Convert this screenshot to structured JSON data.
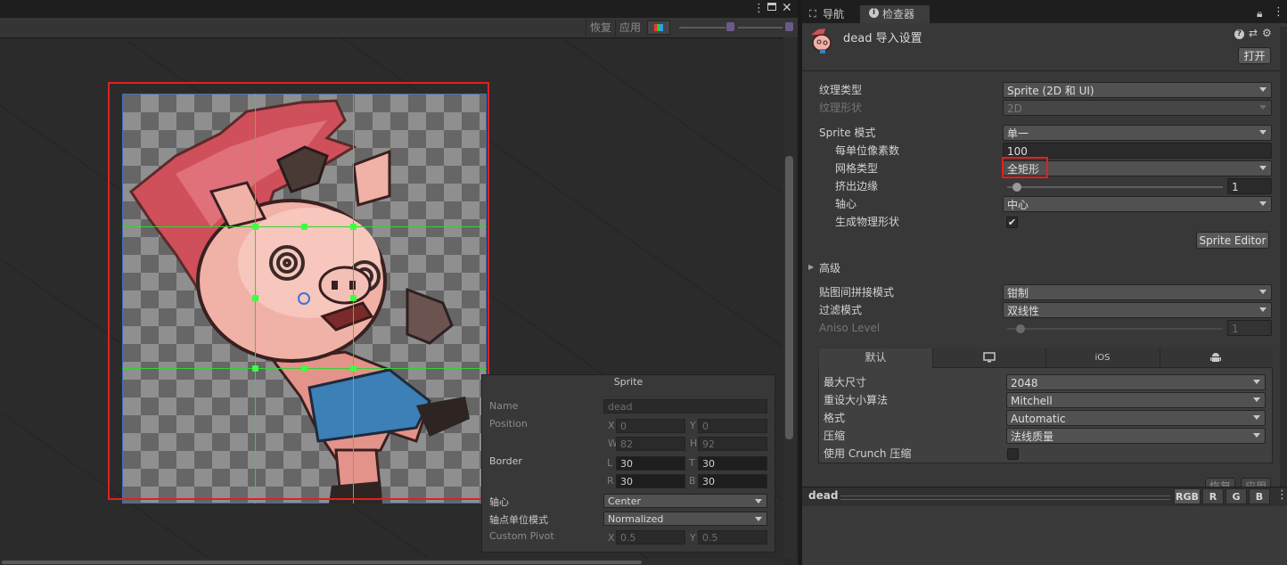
{
  "editor": {
    "toolbar": {
      "revert": "恢复",
      "apply": "应用"
    },
    "popup": {
      "title": "Sprite",
      "name_label": "Name",
      "name_value": "dead",
      "position_label": "Position",
      "x_label": "X",
      "x_value": "0",
      "y_label": "Y",
      "y_value": "0",
      "w_label": "W",
      "w_value": "82",
      "h_label": "H",
      "h_value": "92",
      "border_label": "Border",
      "l_label": "L",
      "l_value": "30",
      "t_label": "T",
      "t_value": "30",
      "r_label": "R",
      "r_value": "30",
      "b_label": "B",
      "b_value": "30",
      "pivot_label": "轴心",
      "pivot_value": "Center",
      "pivot_unit_label": "轴点单位模式",
      "pivot_unit_value": "Normalized",
      "custom_pivot_label": "Custom Pivot",
      "cx_label": "X",
      "cx_value": "0.5",
      "cy_label": "Y",
      "cy_value": "0.5"
    }
  },
  "inspector": {
    "tabs": {
      "navigation": "导航",
      "inspector": "检查器"
    },
    "asset_title": "dead 导入设置",
    "open_button": "打开",
    "texture_type_label": "纹理类型",
    "texture_type_value": "Sprite (2D 和 UI)",
    "texture_shape_label": "纹理形状",
    "texture_shape_value": "2D",
    "sprite_mode_label": "Sprite 模式",
    "sprite_mode_value": "单一",
    "ppu_label": "每单位像素数",
    "ppu_value": "100",
    "mesh_type_label": "网格类型",
    "mesh_type_value": "全矩形",
    "extrude_label": "挤出边缘",
    "extrude_value": "1",
    "pivot_label": "轴心",
    "pivot_value": "中心",
    "physics_label": "生成物理形状",
    "physics_checked": "✔",
    "sprite_editor_button": "Sprite Editor",
    "advanced_label": "高级",
    "wrap_label": "贴图间拼接模式",
    "wrap_value": "钳制",
    "filter_label": "过滤模式",
    "filter_value": "双线性",
    "aniso_label": "Aniso Level",
    "aniso_value": "1",
    "platform_tabs": {
      "default": "默认",
      "ios": "iOS"
    },
    "max_size_label": "最大尺寸",
    "max_size_value": "2048",
    "resize_label": "重设大小算法",
    "resize_value": "Mitchell",
    "format_label": "格式",
    "format_value": "Automatic",
    "compression_label": "压缩",
    "compression_value": "法线质量",
    "crunch_label": "使用 Crunch 压缩",
    "revert_button": "恢复",
    "apply_button": "应用",
    "preview": {
      "name": "dead",
      "rgb": "RGB",
      "r": "R",
      "g": "G",
      "b": "B"
    }
  },
  "colors": {
    "highlight_red": "#e02020",
    "grid_green": "#3dff3d",
    "bounds_blue": "#3f6fbf"
  },
  "icons": [
    "more-vert-icon",
    "maximize-icon",
    "close-icon",
    "color-swatch-icon",
    "navigation-icon",
    "info-icon",
    "lock-icon",
    "help-icon",
    "preset-icon",
    "settings-icon",
    "monitor-icon",
    "android-icon",
    "pig-sprite-thumbnail"
  ]
}
